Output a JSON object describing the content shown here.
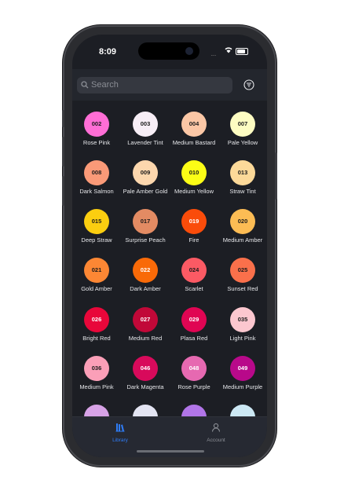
{
  "status": {
    "time": "8:09"
  },
  "search": {
    "placeholder": "Search"
  },
  "colors": [
    {
      "code": "002",
      "name": "Rose Pink",
      "hex": "#ff6ed6",
      "text": "#1a1a1a"
    },
    {
      "code": "003",
      "name": "Lavender Tint",
      "hex": "#f7eef6",
      "text": "#1a1a1a"
    },
    {
      "code": "004",
      "name": "Medium Bastard",
      "hex": "#fbc7a6",
      "text": "#1a1a1a"
    },
    {
      "code": "007",
      "name": "Pale Yellow",
      "hex": "#fdfcc2",
      "text": "#1a1a1a"
    },
    {
      "code": "008",
      "name": "Dark Salmon",
      "hex": "#fa9a78",
      "text": "#1a1a1a"
    },
    {
      "code": "009",
      "name": "Pale Amber Gold",
      "hex": "#fcd7ae",
      "text": "#1a1a1a"
    },
    {
      "code": "010",
      "name": "Medium Yellow",
      "hex": "#fcfd16",
      "text": "#1a1a1a"
    },
    {
      "code": "013",
      "name": "Straw Tint",
      "hex": "#fcd999",
      "text": "#1a1a1a"
    },
    {
      "code": "015",
      "name": "Deep Straw",
      "hex": "#fbce10",
      "text": "#1a1a1a"
    },
    {
      "code": "017",
      "name": "Surprise Peach",
      "hex": "#e38b63",
      "text": "#1a1a1a"
    },
    {
      "code": "019",
      "name": "Fire",
      "hex": "#fa4c0a",
      "text": "#ffffff"
    },
    {
      "code": "020",
      "name": "Medium Amber",
      "hex": "#fcbc54",
      "text": "#1a1a1a"
    },
    {
      "code": "021",
      "name": "Gold Amber",
      "hex": "#fc8734",
      "text": "#1a1a1a"
    },
    {
      "code": "022",
      "name": "Dark Amber",
      "hex": "#f96a08",
      "text": "#ffffff"
    },
    {
      "code": "024",
      "name": "Scarlet",
      "hex": "#fb5a64",
      "text": "#1a1a1a"
    },
    {
      "code": "025",
      "name": "Sunset Red",
      "hex": "#fa704b",
      "text": "#1a1a1a"
    },
    {
      "code": "026",
      "name": "Bright Red",
      "hex": "#e8073a",
      "text": "#ffffff"
    },
    {
      "code": "027",
      "name": "Medium Red",
      "hex": "#c10838",
      "text": "#ffffff"
    },
    {
      "code": "029",
      "name": "Plasa Red",
      "hex": "#e00553",
      "text": "#ffffff"
    },
    {
      "code": "035",
      "name": "Light Pink",
      "hex": "#fcc7cf",
      "text": "#1a1a1a"
    },
    {
      "code": "036",
      "name": "Medium Pink",
      "hex": "#fb9fb8",
      "text": "#1a1a1a"
    },
    {
      "code": "046",
      "name": "Dark Magenta",
      "hex": "#d80a5b",
      "text": "#ffffff"
    },
    {
      "code": "048",
      "name": "Rose Purple",
      "hex": "#e669b1",
      "text": "#ffffff"
    },
    {
      "code": "049",
      "name": "Medium Purple",
      "hex": "#b8098a",
      "text": "#ffffff"
    },
    {
      "code": "",
      "name": "",
      "hex": "#d7a2e6",
      "text": "#1a1a1a"
    },
    {
      "code": "",
      "name": "",
      "hex": "#e3e4f2",
      "text": "#1a1a1a"
    },
    {
      "code": "",
      "name": "",
      "hex": "#b175e8",
      "text": "#1a1a1a"
    },
    {
      "code": "",
      "name": "",
      "hex": "#cce8f4",
      "text": "#1a1a1a"
    }
  ],
  "tabs": [
    {
      "label": "Library",
      "icon": "library-icon",
      "active": true,
      "color": "#2f7cf6"
    },
    {
      "label": "Account",
      "icon": "account-icon",
      "active": false,
      "color": "#8b8e95"
    }
  ]
}
